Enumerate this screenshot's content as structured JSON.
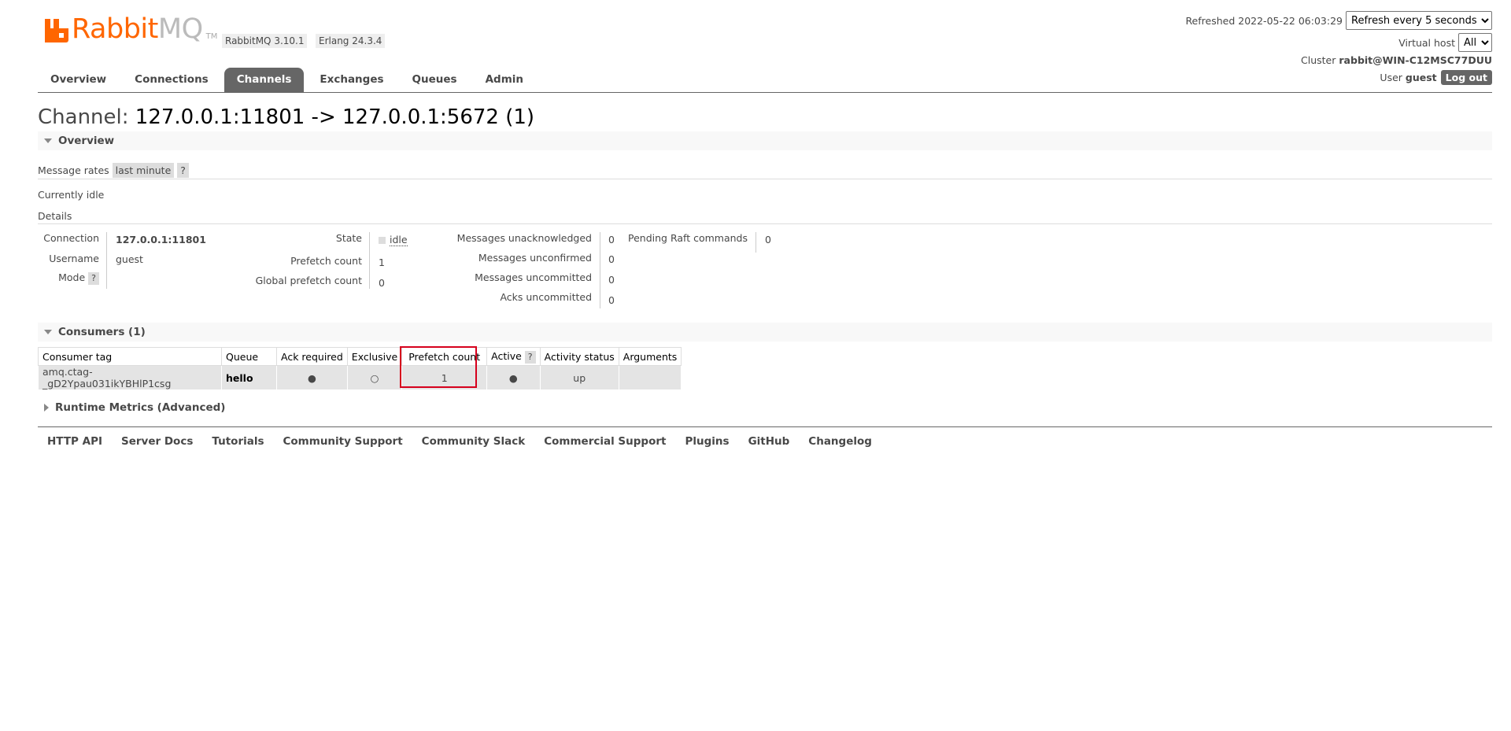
{
  "header": {
    "logo_part1": "Rabbit",
    "logo_part2": "MQ",
    "logo_tm": "TM",
    "rabbitmq_version": "RabbitMQ 3.10.1",
    "erlang_version": "Erlang 24.3.4",
    "refreshed_label": "Refreshed 2022-05-22 06:03:29",
    "refresh_select": "Refresh every 5 seconds",
    "virtual_host_label": "Virtual host",
    "virtual_host_value": "All",
    "cluster_label": "Cluster",
    "cluster_value": "rabbit@WIN-C12MSC77DUU",
    "user_label": "User",
    "user_value": "guest",
    "logout_label": "Log out"
  },
  "tabs": [
    {
      "label": "Overview"
    },
    {
      "label": "Connections"
    },
    {
      "label": "Channels",
      "active": true
    },
    {
      "label": "Exchanges"
    },
    {
      "label": "Queues"
    },
    {
      "label": "Admin"
    }
  ],
  "page": {
    "title_prefix": "Channel:",
    "title_value": "127.0.0.1:11801 -> 127.0.0.1:5672 (1)"
  },
  "overview": {
    "section_title": "Overview",
    "message_rates_label": "Message rates",
    "message_rates_period": "last minute",
    "help": "?",
    "idle_text": "Currently idle",
    "details_label": "Details",
    "connection_label": "Connection",
    "connection_value": "127.0.0.1:11801",
    "username_label": "Username",
    "username_value": "guest",
    "mode_label": "Mode",
    "state_label": "State",
    "state_value": "idle",
    "prefetch_label": "Prefetch count",
    "prefetch_value": "1",
    "global_prefetch_label": "Global prefetch count",
    "global_prefetch_value": "0",
    "unacked_label": "Messages unacknowledged",
    "unacked_value": "0",
    "unconfirmed_label": "Messages unconfirmed",
    "unconfirmed_value": "0",
    "uncommitted_label": "Messages uncommitted",
    "uncommitted_value": "0",
    "acks_uncommitted_label": "Acks uncommitted",
    "acks_uncommitted_value": "0",
    "raft_label": "Pending Raft commands",
    "raft_value": "0"
  },
  "consumers": {
    "section_title": "Consumers (1)",
    "columns": [
      "Consumer tag",
      "Queue",
      "Ack required",
      "Exclusive",
      "Prefetch count",
      "Active",
      "Activity status",
      "Arguments"
    ],
    "rows": [
      {
        "consumer_tag": "amq.ctag-_gD2Ypau031ikYBHlP1csg",
        "queue": "hello",
        "ack_required": "●",
        "exclusive": "○",
        "prefetch_count": "1",
        "active": "●",
        "activity_status": "up",
        "arguments": ""
      }
    ]
  },
  "runtime_metrics": {
    "section_title": "Runtime Metrics (Advanced)"
  },
  "footer": {
    "links": [
      "HTTP API",
      "Server Docs",
      "Tutorials",
      "Community Support",
      "Community Slack",
      "Commercial Support",
      "Plugins",
      "GitHub",
      "Changelog"
    ]
  },
  "colors": {
    "brand": "#ff6600",
    "tab_active": "#666666",
    "highlight_box": "#d6001c"
  }
}
